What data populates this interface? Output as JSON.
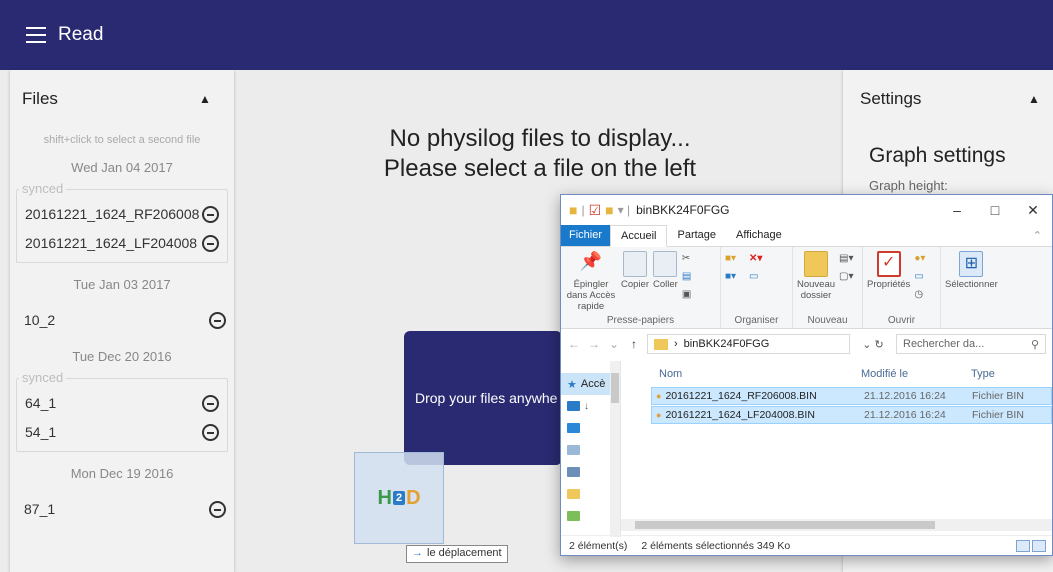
{
  "appbar": {
    "title": "Read"
  },
  "files_panel": {
    "title": "Files",
    "hint": "shift+click to select a second file",
    "groups": [
      {
        "date": "Wed Jan 04 2017",
        "synced_label": "synced",
        "synced_files": [
          "20161221_1624_RF206008",
          "20161221_1624_LF204008"
        ]
      },
      {
        "date": "Tue Jan 03 2017",
        "loose_files": [
          "10_2"
        ]
      },
      {
        "date": "Tue Dec 20 2016",
        "synced_label": "synced",
        "synced_files": [
          "64_1",
          "54_1"
        ]
      },
      {
        "date": "Mon Dec 19 2016",
        "loose_files": [
          "87_1"
        ]
      }
    ]
  },
  "main": {
    "message_line1": "No physilog files to display...",
    "message_line2": "Please select a file on the left",
    "drop_text": "Drop your files anywhe"
  },
  "settings_panel": {
    "title": "Settings",
    "graph_settings": "Graph settings",
    "graph_height_label": "Graph height:"
  },
  "drag": {
    "logo_h": "H",
    "logo_2": "2",
    "logo_d": "D",
    "tooltip_arrow": "→",
    "tooltip": "le déplacement"
  },
  "explorer": {
    "title": "binBKK24F0FGG",
    "tabs": [
      "Fichier",
      "Accueil",
      "Partage",
      "Affichage"
    ],
    "window_buttons": {
      "minimize": "–",
      "maximize": "□",
      "close": "✕"
    },
    "ribbon": {
      "presse_papiers": {
        "label": "Presse-papiers",
        "pin": "Épingler dans Accès rapide",
        "copy": "Copier",
        "paste": "Coller"
      },
      "organiser": {
        "label": "Organiser"
      },
      "nouveau": {
        "label": "Nouveau",
        "new_folder": "Nouveau dossier"
      },
      "ouvrir": {
        "label": "Ouvrir",
        "properties": "Propriétés"
      },
      "select": {
        "label": "Sélectionner"
      }
    },
    "address": {
      "path": "binBKK24F0FGG",
      "search_placeholder": "Rechercher da..."
    },
    "nav": {
      "acces": "Accè"
    },
    "columns": {
      "name": "Nom",
      "modified": "Modifié le",
      "type": "Type"
    },
    "files": [
      {
        "name": "20161221_1624_RF206008.BIN",
        "modified": "21.12.2016 16:24",
        "type": "Fichier BIN"
      },
      {
        "name": "20161221_1624_LF204008.BIN",
        "modified": "21.12.2016 16:24",
        "type": "Fichier BIN"
      }
    ],
    "status": {
      "count": "2 élément(s)",
      "selected": "2 éléments sélectionnés  349 Ko"
    }
  }
}
